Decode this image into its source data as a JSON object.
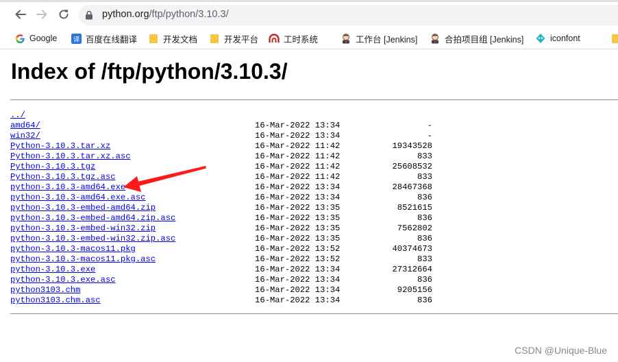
{
  "browser": {
    "url_host": "python.org",
    "url_path": "/ftp/python/3.10.3/"
  },
  "bookmarks": [
    {
      "label": "Google",
      "icon": "google-icon"
    },
    {
      "label": "百度在线翻译",
      "icon": "translate-icon"
    },
    {
      "label": "开发文档",
      "icon": "folder-icon"
    },
    {
      "label": "开发平台",
      "icon": "folder-icon"
    },
    {
      "label": "工时系统",
      "icon": "arch-icon"
    },
    {
      "label": "工作台 [Jenkins]",
      "icon": "jenkins-icon"
    },
    {
      "label": "合拍项目组 [Jenkins]",
      "icon": "jenkins-icon"
    },
    {
      "label": "iconfont",
      "icon": "iconfont-icon"
    }
  ],
  "page": {
    "title": "Index of /ftp/python/3.10.3/"
  },
  "files": [
    {
      "name": "../",
      "date": "",
      "size": ""
    },
    {
      "name": "amd64/",
      "date": "16-Mar-2022 13:34",
      "size": "-"
    },
    {
      "name": "win32/",
      "date": "16-Mar-2022 13:34",
      "size": "-"
    },
    {
      "name": "Python-3.10.3.tar.xz",
      "date": "16-Mar-2022 11:42",
      "size": "19343528"
    },
    {
      "name": "Python-3.10.3.tar.xz.asc",
      "date": "16-Mar-2022 11:42",
      "size": "833"
    },
    {
      "name": "Python-3.10.3.tgz",
      "date": "16-Mar-2022 11:42",
      "size": "25608532"
    },
    {
      "name": "Python-3.10.3.tgz.asc",
      "date": "16-Mar-2022 11:42",
      "size": "833"
    },
    {
      "name": "python-3.10.3-amd64.exe",
      "date": "16-Mar-2022 13:34",
      "size": "28467368"
    },
    {
      "name": "python-3.10.3-amd64.exe.asc",
      "date": "16-Mar-2022 13:34",
      "size": "836"
    },
    {
      "name": "python-3.10.3-embed-amd64.zip",
      "date": "16-Mar-2022 13:35",
      "size": "8521615"
    },
    {
      "name": "python-3.10.3-embed-amd64.zip.asc",
      "date": "16-Mar-2022 13:35",
      "size": "836"
    },
    {
      "name": "python-3.10.3-embed-win32.zip",
      "date": "16-Mar-2022 13:35",
      "size": "7562802"
    },
    {
      "name": "python-3.10.3-embed-win32.zip.asc",
      "date": "16-Mar-2022 13:35",
      "size": "836"
    },
    {
      "name": "python-3.10.3-macos11.pkg",
      "date": "16-Mar-2022 13:52",
      "size": "40374673"
    },
    {
      "name": "python-3.10.3-macos11.pkg.asc",
      "date": "16-Mar-2022 13:52",
      "size": "833"
    },
    {
      "name": "python-3.10.3.exe",
      "date": "16-Mar-2022 13:34",
      "size": "27312664"
    },
    {
      "name": "python-3.10.3.exe.asc",
      "date": "16-Mar-2022 13:34",
      "size": "836"
    },
    {
      "name": "python3103.chm",
      "date": "16-Mar-2022 13:34",
      "size": "9205156"
    },
    {
      "name": "python3103.chm.asc",
      "date": "16-Mar-2022 13:34",
      "size": "836"
    }
  ],
  "watermark": "CSDN @Unique-Blue",
  "colors": {
    "link": "#0000ee",
    "annotation_arrow": "#ff1a1a"
  }
}
